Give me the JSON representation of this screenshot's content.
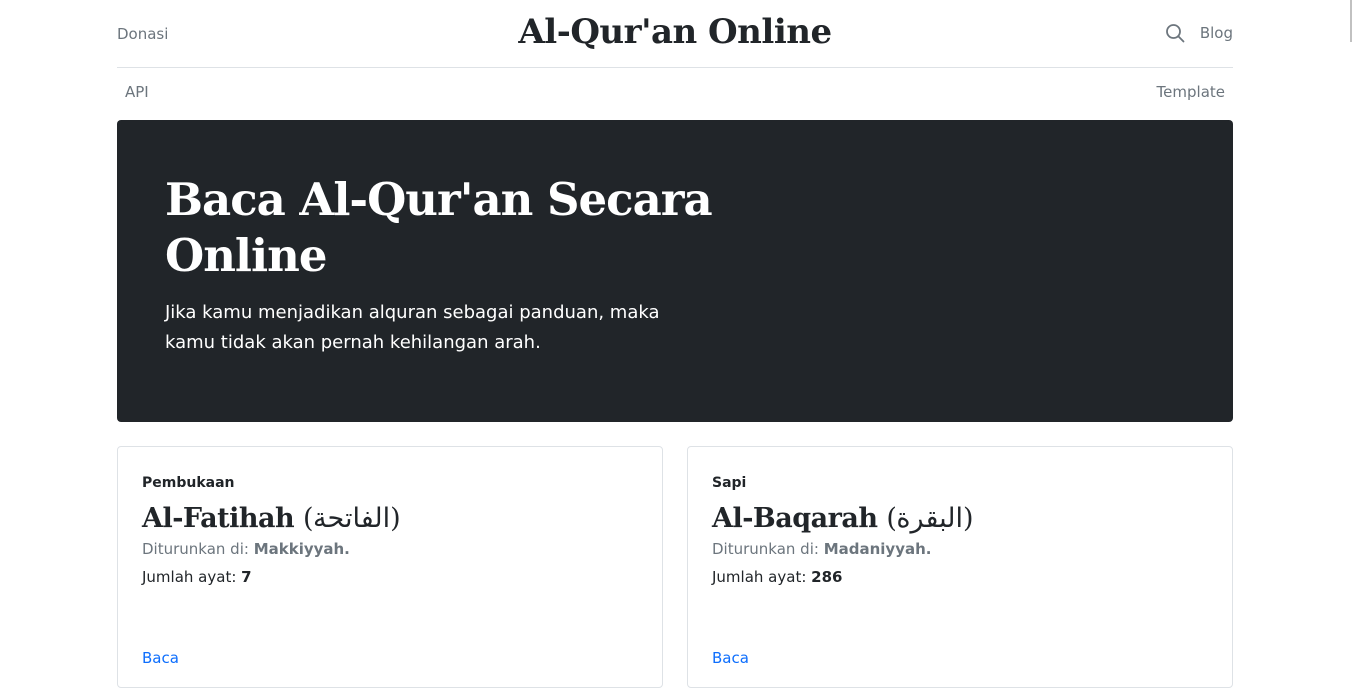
{
  "header": {
    "donate_label": "Donasi",
    "brand_title": "Al-Qur'an Online",
    "blog_label": "Blog",
    "search_icon": "search-icon"
  },
  "subnav": {
    "api_label": "API",
    "template_label": "Template"
  },
  "hero": {
    "title": "Baca Al-Qur'an Secara Online",
    "lead": "Jika kamu menjadikan alquran sebagai panduan, maka kamu tidak akan pernah kehilangan arah.",
    "background": "#212529"
  },
  "cards": [
    {
      "meaning": "Pembukaan",
      "latin_name": "Al-Fatihah",
      "arabic_name": "(الفاتحة)",
      "revealed_label": "Diturunkan di: ",
      "revealed_place": "Makkiyyah.",
      "ayat_label": "Jumlah ayat: ",
      "ayat_count": "7",
      "link_label": "Baca"
    },
    {
      "meaning": "Sapi",
      "latin_name": "Al-Baqarah",
      "arabic_name": "(البقرة)",
      "revealed_label": "Diturunkan di: ",
      "revealed_place": "Madaniyyah.",
      "ayat_label": "Jumlah ayat: ",
      "ayat_count": "286",
      "link_label": "Baca"
    }
  ],
  "colors": {
    "muted": "#6c757d",
    "text": "#212529",
    "link": "#0d6efd",
    "border": "#dee2e6"
  }
}
